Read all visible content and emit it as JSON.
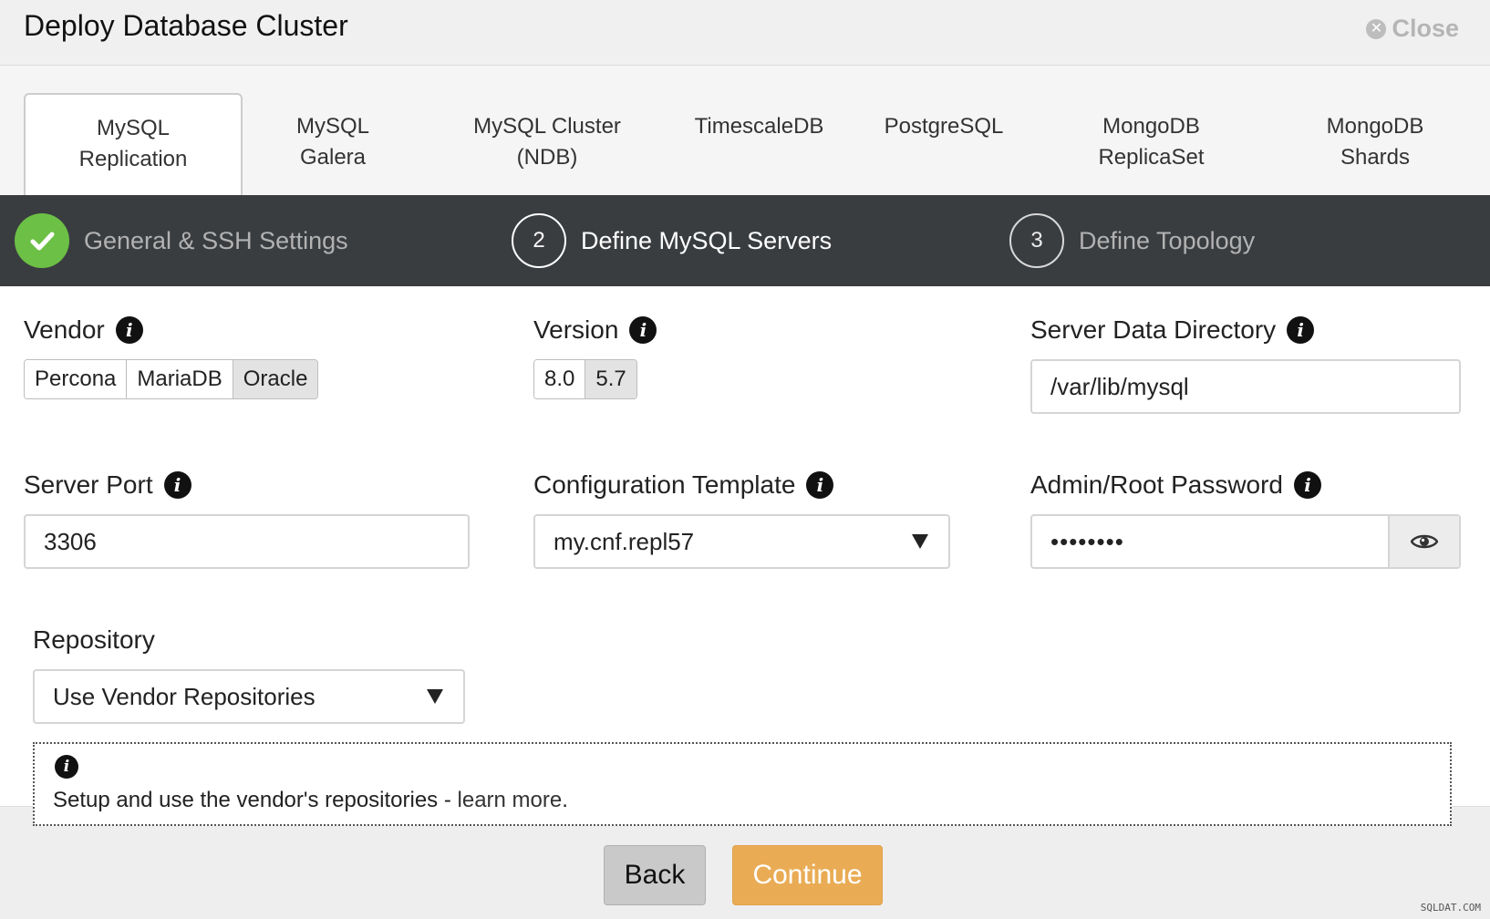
{
  "dialog": {
    "title": "Deploy Database Cluster",
    "close_label": "Close"
  },
  "tabs": [
    {
      "line1": "MySQL",
      "line2": "Replication"
    },
    {
      "line1": "MySQL",
      "line2": "Galera"
    },
    {
      "line1": "MySQL Cluster",
      "line2": "(NDB)"
    },
    {
      "line1": "TimescaleDB",
      "line2": ""
    },
    {
      "line1": "PostgreSQL",
      "line2": ""
    },
    {
      "line1": "MongoDB",
      "line2": "ReplicaSet"
    },
    {
      "line1": "MongoDB",
      "line2": "Shards"
    }
  ],
  "steps": [
    {
      "number": "",
      "label": "General & SSH Settings",
      "state": "done"
    },
    {
      "number": "2",
      "label": "Define MySQL Servers",
      "state": "current"
    },
    {
      "number": "3",
      "label": "Define Topology",
      "state": "pending"
    }
  ],
  "form": {
    "vendor": {
      "label": "Vendor",
      "options": [
        "Percona",
        "MariaDB",
        "Oracle"
      ],
      "selected": "Oracle"
    },
    "version": {
      "label": "Version",
      "options": [
        "8.0",
        "5.7"
      ],
      "selected": "5.7"
    },
    "data_dir": {
      "label": "Server Data Directory",
      "value": "/var/lib/mysql"
    },
    "port": {
      "label": "Server Port",
      "value": "3306"
    },
    "config_template": {
      "label": "Configuration Template",
      "value": "my.cnf.repl57"
    },
    "admin_password": {
      "label": "Admin/Root Password",
      "masked_value": "••••••••"
    },
    "repository": {
      "label": "Repository",
      "value": "Use Vendor Repositories"
    },
    "info": {
      "text": "Setup and use the vendor's repositories - ",
      "link_text": "learn more",
      "suffix": "."
    }
  },
  "footer": {
    "back_label": "Back",
    "continue_label": "Continue"
  },
  "watermark": "SQLDAT.COM",
  "colors": {
    "accent": "#e9ac55",
    "success": "#6cc046",
    "stepbar": "#3a3d40"
  }
}
